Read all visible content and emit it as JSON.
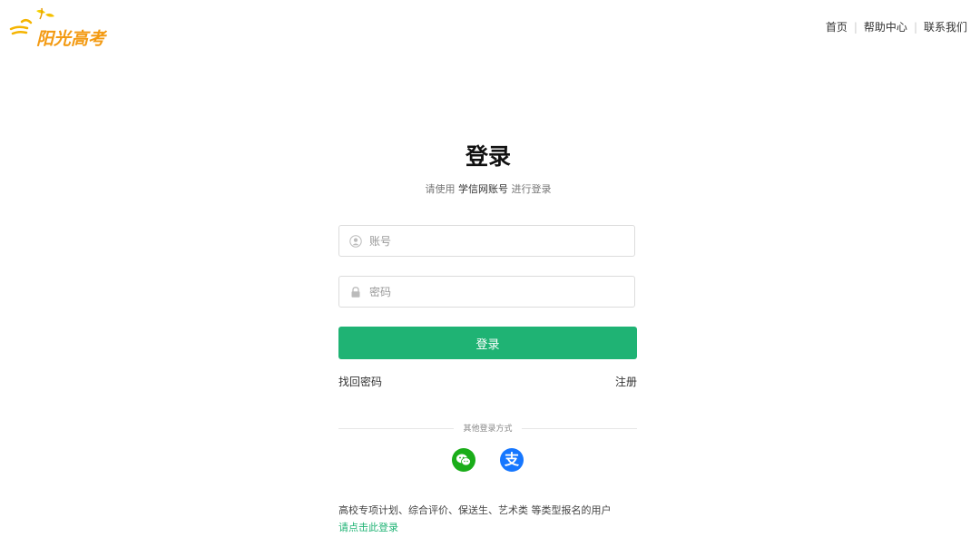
{
  "header": {
    "logo_text": "阳光高考",
    "nav": [
      {
        "label": "首页"
      },
      {
        "label": "帮助中心"
      },
      {
        "label": "联系我们"
      }
    ]
  },
  "login": {
    "title": "登录",
    "subtitle_prefix": "请使用 ",
    "subtitle_strong": "学信网账号",
    "subtitle_suffix": " 进行登录",
    "username_placeholder": "账号",
    "password_placeholder": "密码",
    "submit_label": "登录",
    "forgot_label": "找回密码",
    "register_label": "注册",
    "other_methods_label": "其他登录方式",
    "notice_text": "高校专项计划、综合评价、保送生、艺术类 等类型报名的用户",
    "notice_link": "请点击此登录",
    "alipay_glyph": "支"
  },
  "colors": {
    "accent": "#1fb374",
    "logo": "#f39a12",
    "wechat": "#1aad19",
    "alipay": "#1677ff"
  }
}
